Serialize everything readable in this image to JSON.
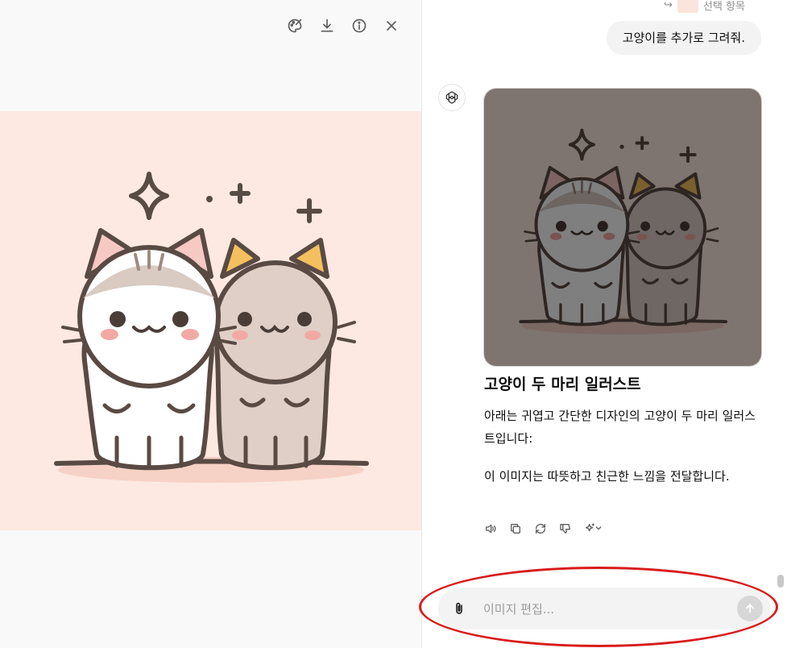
{
  "viewer": {
    "toolbar": {
      "icons": [
        "edit-brush-icon",
        "download-icon",
        "info-icon",
        "close-icon"
      ]
    }
  },
  "chat": {
    "prev_item_label": "선택 항목",
    "user_message": "고양이를 추가로 그려줘.",
    "response": {
      "title": "고양이 두 마리 일러스트",
      "paragraph1": "아래는 귀엽고 간단한 디자인의 고양이 두 마리 일러스트입니다:",
      "paragraph2": "이 이미지는 따뜻하고 친근한 느낌을 전달합니다."
    },
    "action_icons": [
      "speaker-icon",
      "copy-icon",
      "regenerate-icon",
      "thumbs-down-icon",
      "sparkle-menu-icon"
    ]
  },
  "composer": {
    "placeholder": "이미지 편집..."
  },
  "colors": {
    "highlight": "#d91c1c",
    "image_background": "#fde9e1",
    "outline": "#5a4a44"
  }
}
